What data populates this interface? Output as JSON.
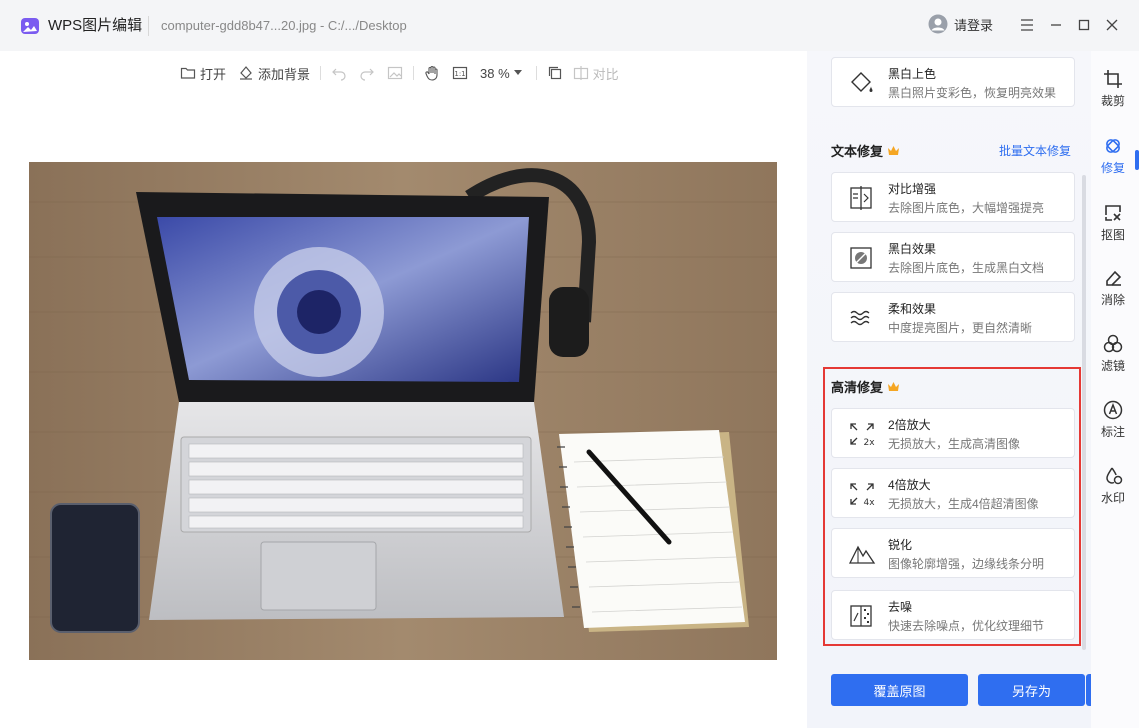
{
  "titlebar": {
    "app_name": "WPS图片编辑",
    "file_name": "computer-gdd8b47...20.jpg - C:/.../Desktop",
    "login_label": "请登录"
  },
  "toolbar": {
    "open_label": "打开",
    "add_bg_label": "添加背景",
    "zoom": "38 %",
    "compare_label": "对比"
  },
  "panel": {
    "top_card": {
      "title": "黑白上色",
      "desc": "黑白照片变彩色，恢复明亮效果"
    },
    "text_repair": {
      "title": "文本修复",
      "batch_label": "批量文本修复",
      "items": [
        {
          "title": "对比增强",
          "desc": "去除图片底色，大幅增强提亮"
        },
        {
          "title": "黑白效果",
          "desc": "去除图片底色，生成黑白文档"
        },
        {
          "title": "柔和效果",
          "desc": "中度提亮图片，更自然清晰"
        }
      ]
    },
    "hd_repair": {
      "title": "高清修复",
      "items": [
        {
          "title": "2倍放大",
          "desc": "无损放大，生成高清图像",
          "icon_text": "2x"
        },
        {
          "title": "4倍放大",
          "desc": "无损放大，生成4倍超清图像",
          "icon_text": "4x"
        },
        {
          "title": "锐化",
          "desc": "图像轮廓增强，边缘线条分明"
        },
        {
          "title": "去噪",
          "desc": "快速去除噪点，优化纹理细节"
        }
      ]
    },
    "overwrite_label": "覆盖原图",
    "save_as_label": "另存为"
  },
  "rail": {
    "items": [
      {
        "label": "裁剪",
        "icon": "crop-icon"
      },
      {
        "label": "修复",
        "icon": "repair-icon"
      },
      {
        "label": "抠图",
        "icon": "cutout-icon"
      },
      {
        "label": "消除",
        "icon": "eraser-icon"
      },
      {
        "label": "滤镜",
        "icon": "filter-icon"
      },
      {
        "label": "标注",
        "icon": "annotate-icon"
      },
      {
        "label": "水印",
        "icon": "watermark-icon"
      }
    ]
  },
  "colors": {
    "accent": "#2f6ef0",
    "highlight": "#e53935",
    "crown": "#f5a623"
  }
}
